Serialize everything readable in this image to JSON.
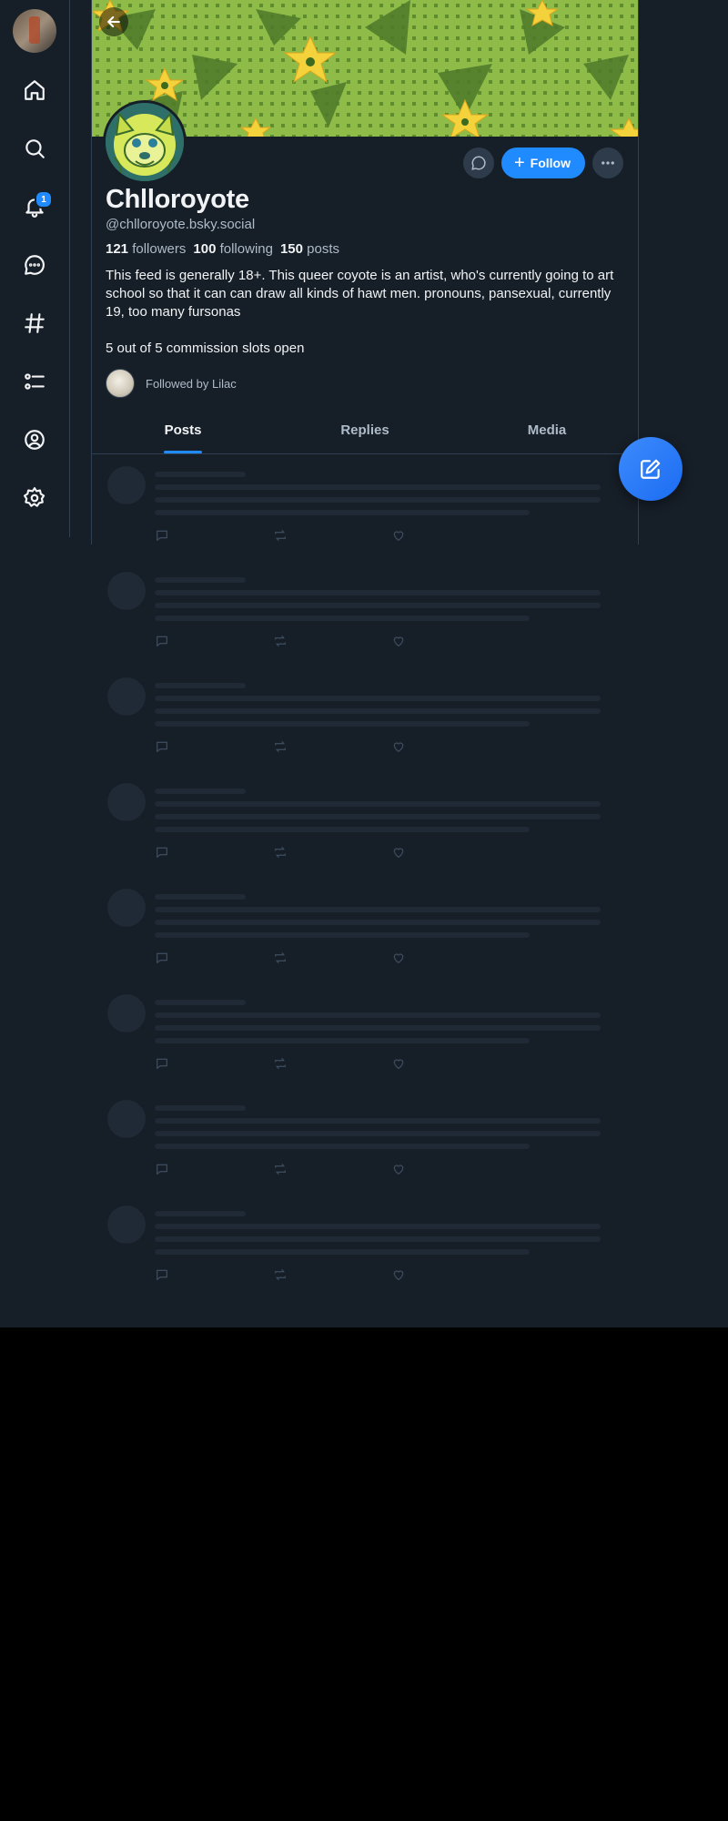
{
  "nav": {
    "notifications_badge": "1",
    "items": [
      "home-icon",
      "search-icon",
      "bell-icon",
      "chat-icon",
      "hashtag-icon",
      "list-icon",
      "profile-icon",
      "gear-icon"
    ]
  },
  "profile": {
    "display_name": "Chlloroyote",
    "handle": "@chlloroyote.bsky.social",
    "followers_count": "121",
    "followers_label": "followers",
    "following_count": "100",
    "following_label": "following",
    "posts_count": "150",
    "posts_label": "posts",
    "bio_1": "This feed is generally 18+. This queer coyote is an artist, who's currently going to art school so that it can can draw all kinds of hawt men. pronouns, pansexual, currently 19, too many fursonas",
    "bio_2": "5 out of 5 commission slots open",
    "followed_by": "Followed by Lilac",
    "follow_label": "Follow"
  },
  "tabs": [
    "Posts",
    "Replies",
    "Media"
  ],
  "active_tab": "Posts",
  "colors": {
    "accent": "#208bfe",
    "background": "#161e27",
    "skeleton": "#1f2a36",
    "banner_green": "#8fbc49"
  }
}
